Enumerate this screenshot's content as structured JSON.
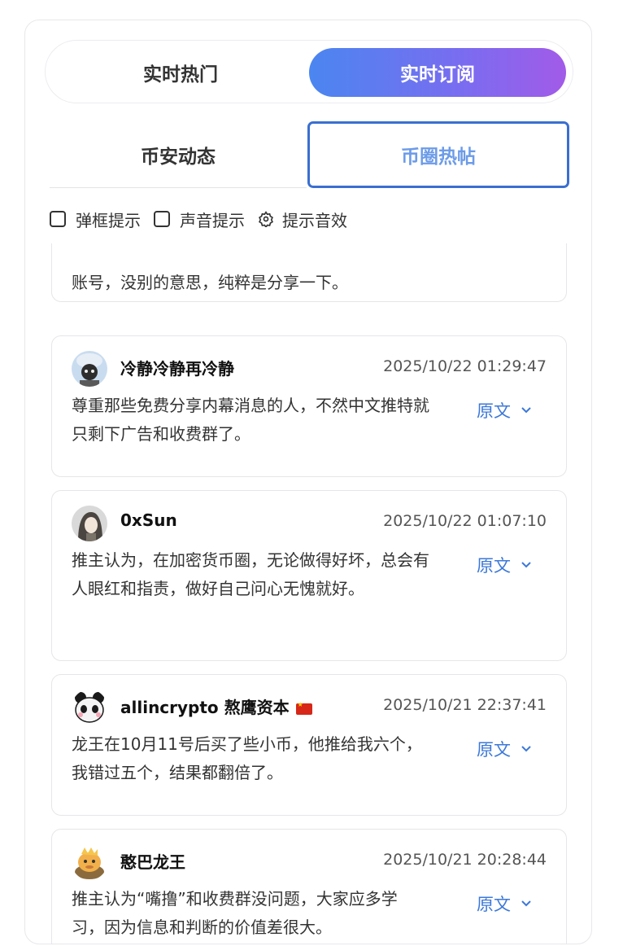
{
  "main_tabs": {
    "hot": "实时热门",
    "subscribe": "实时订阅"
  },
  "sub_tabs": {
    "binance": "币安动态",
    "crypto_posts": "币圈热帖"
  },
  "options": {
    "popup": "弹框提示",
    "sound": "声音提示",
    "sound_effect": "提示音效"
  },
  "partial_card": {
    "text": "账号，没别的意思，纯粹是分享一下。"
  },
  "posts": [
    {
      "user": "冷静冷静再冷静",
      "time": "2025/10/22 01:29:47",
      "text": "尊重那些免费分享内幕消息的人，不然中文推特就只剩下广告和收费群了。",
      "original_label": "原文"
    },
    {
      "user": "0xSun",
      "time": "2025/10/22 01:07:10",
      "text": "推主认为，在加密货币圈，无论做得好坏，总会有人眼红和指责，做好自己问心无愧就好。",
      "original_label": "原文"
    },
    {
      "user": "allincrypto 熬鹰资本",
      "time": "2025/10/21 22:37:41",
      "text": "龙王在10月11号后买了些小币，他推给我六个，我错过五个，结果都翻倍了。",
      "original_label": "原文"
    },
    {
      "user": "憨巴龙王",
      "time": "2025/10/21 20:28:44",
      "text": "推主认为“嘴撸”和收费群没问题，大家应多学习，因为信息和判断的价值差很大。",
      "original_label": "原文"
    }
  ]
}
